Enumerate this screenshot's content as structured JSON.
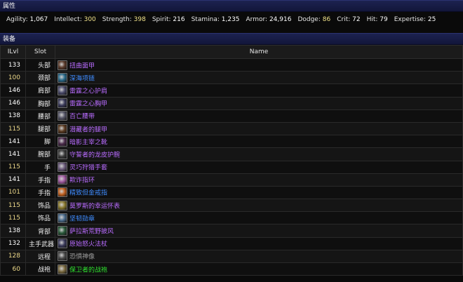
{
  "attributes_header": "属性",
  "equipment_header": "装备",
  "stats": [
    {
      "label": "Agility:",
      "value": "1,067",
      "accent": false
    },
    {
      "label": "Intellect:",
      "value": "300",
      "accent": true
    },
    {
      "label": "Strength:",
      "value": "398",
      "accent": true
    },
    {
      "label": "Spirit:",
      "value": "216",
      "accent": false
    },
    {
      "label": "Stamina:",
      "value": "1,235",
      "accent": false
    },
    {
      "label": "Armor:",
      "value": "24,916",
      "accent": false
    },
    {
      "label": "Dodge:",
      "value": "86",
      "accent": true
    },
    {
      "label": "Crit:",
      "value": "72",
      "accent": false
    },
    {
      "label": "Hit:",
      "value": "79",
      "accent": false
    },
    {
      "label": "Expertise:",
      "value": "25",
      "accent": false
    }
  ],
  "table": {
    "headers": {
      "ilvl": "ILvl",
      "slot": "Slot",
      "name": "Name"
    },
    "rows": [
      {
        "ilvl": "133",
        "slot": "头部",
        "name": "扭曲面甲",
        "quality": "epic",
        "icon_color": "#5a3a2a",
        "hi": false
      },
      {
        "ilvl": "100",
        "slot": "颈部",
        "name": "深海项链",
        "quality": "rare",
        "icon_color": "#2a6a8a",
        "hi": true
      },
      {
        "ilvl": "146",
        "slot": "肩部",
        "name": "雷霆之心护肩",
        "quality": "epic",
        "icon_color": "#4a4a6a",
        "hi": false
      },
      {
        "ilvl": "146",
        "slot": "胸部",
        "name": "雷霆之心胸甲",
        "quality": "epic",
        "icon_color": "#3a3a5a",
        "hi": false
      },
      {
        "ilvl": "138",
        "slot": "腰部",
        "name": "百亡腰带",
        "quality": "epic",
        "icon_color": "#555566",
        "hi": false
      },
      {
        "ilvl": "115",
        "slot": "腿部",
        "name": "潜藏者的腿甲",
        "quality": "epic",
        "icon_color": "#5a3a20",
        "hi": true
      },
      {
        "ilvl": "141",
        "slot": "脚",
        "name": "暗影主宰之靴",
        "quality": "epic",
        "icon_color": "#4a2a4a",
        "hi": false
      },
      {
        "ilvl": "141",
        "slot": "腕部",
        "name": "守誓者的龙皮护腕",
        "quality": "epic",
        "icon_color": "#3a3a3a",
        "hi": false
      },
      {
        "ilvl": "115",
        "slot": "手",
        "name": "灵巧狩猎手套",
        "quality": "epic",
        "icon_color": "#6a5a7a",
        "hi": true
      },
      {
        "ilvl": "141",
        "slot": "手指",
        "name": "欺诈指环",
        "quality": "epic",
        "icon_color": "#a05aa0",
        "hi": false
      },
      {
        "ilvl": "101",
        "slot": "手指",
        "name": "精致但金戒指",
        "quality": "rare",
        "icon_color": "#c06020",
        "hi": true
      },
      {
        "ilvl": "115",
        "slot": "饰品",
        "name": "莫罗斯的幸运怀表",
        "quality": "epic",
        "icon_color": "#8a7a30",
        "hi": true
      },
      {
        "ilvl": "115",
        "slot": "饰品",
        "name": "坚韧勋章",
        "quality": "rare",
        "icon_color": "#4a6a8a",
        "hi": true
      },
      {
        "ilvl": "138",
        "slot": "背部",
        "name": "萨拉斯荒野披风",
        "quality": "epic",
        "icon_color": "#2a5a3a",
        "hi": false
      },
      {
        "ilvl": "132",
        "slot": "主手武器",
        "name": "原始怒火法杖",
        "quality": "epic",
        "icon_color": "#3a3a5a",
        "hi": false
      },
      {
        "ilvl": "128",
        "slot": "远程",
        "name": "恐惧神像",
        "quality": "common",
        "icon_color": "#4a4a4a",
        "hi": true
      },
      {
        "ilvl": "60",
        "slot": "战袍",
        "name": "保卫者的战袍",
        "quality": "uncommon",
        "icon_color": "#7a6a40",
        "hi": true
      }
    ]
  }
}
